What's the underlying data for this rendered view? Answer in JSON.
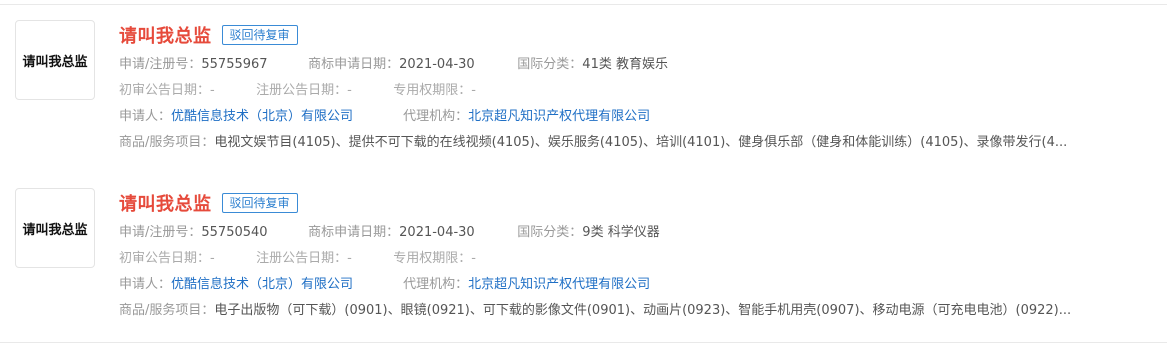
{
  "labels": {
    "app_no": "申请/注册号：",
    "apply_date": "商标申请日期：",
    "intl_class": "国际分类：",
    "first_pub": "初审公告日期：",
    "reg_pub": "注册公告日期：",
    "exclusive": "专用权期限：",
    "applicant": "申请人：",
    "agent": "代理机构：",
    "goods": "商品/服务项目："
  },
  "results": [
    {
      "logo_text": "请叫我总监",
      "name": "请叫我总监",
      "status": "驳回待复审",
      "app_no": "55755967",
      "apply_date": "2021-04-30",
      "intl_class": "41类 教育娱乐",
      "first_pub": "-",
      "reg_pub": "-",
      "exclusive": "-",
      "applicant": "优酷信息技术（北京）有限公司",
      "agent": "北京超凡知识产权代理有限公司",
      "goods": "电视文娱节目(4105)、提供不可下载的在线视频(4105)、娱乐服务(4105)、培训(4101)、健身俱乐部（健身和体能训练）(4105)、录像带发行(4..."
    },
    {
      "logo_text": "请叫我总监",
      "name": "请叫我总监",
      "status": "驳回待复审",
      "app_no": "55750540",
      "apply_date": "2021-04-30",
      "intl_class": "9类 科学仪器",
      "first_pub": "-",
      "reg_pub": "-",
      "exclusive": "-",
      "applicant": "优酷信息技术（北京）有限公司",
      "agent": "北京超凡知识产权代理有限公司",
      "goods": "电子出版物（可下载）(0901)、眼镜(0921)、可下载的影像文件(0901)、动画片(0923)、智能手机用壳(0907)、移动电源（可充电电池）(0922)..."
    }
  ]
}
